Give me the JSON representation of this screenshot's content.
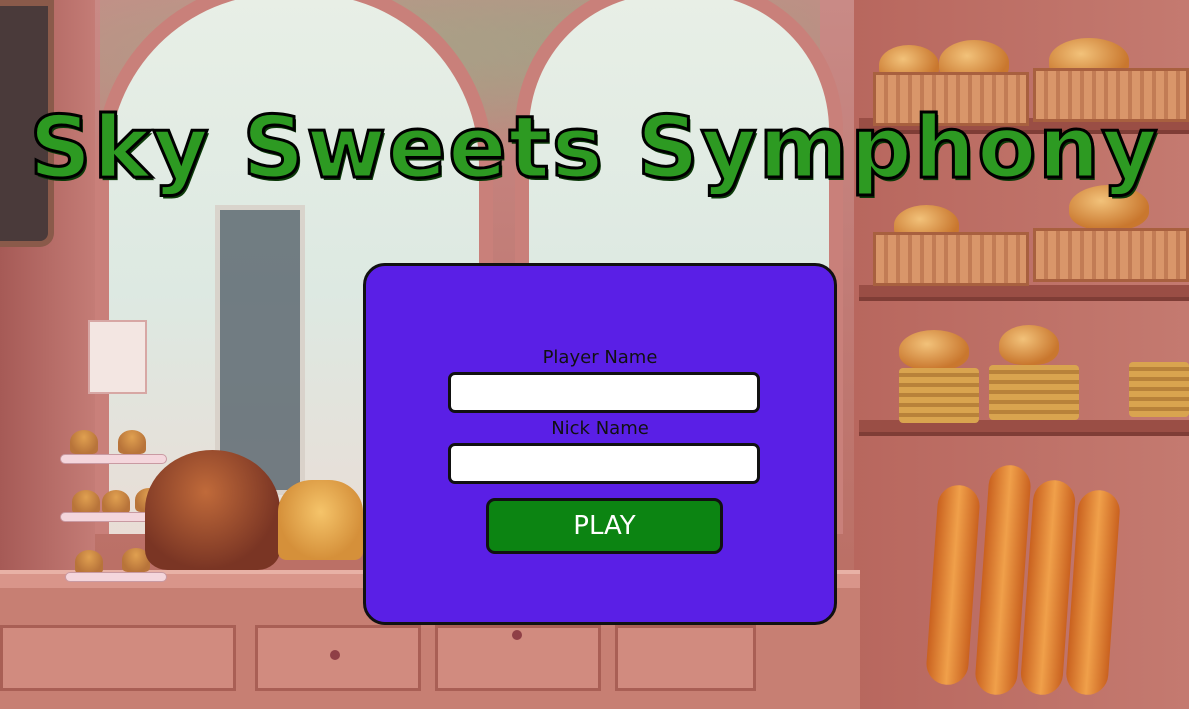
{
  "game": {
    "title": "Sky Sweets Symphony"
  },
  "login_form": {
    "player_name_label": "Player Name",
    "player_name_value": "",
    "nick_name_label": "Nick Name",
    "nick_name_value": "",
    "play_label": "PLAY"
  },
  "colors": {
    "title_green": "#2d9a22",
    "panel_purple": "#5a1fe6",
    "play_green": "#0c8412"
  }
}
